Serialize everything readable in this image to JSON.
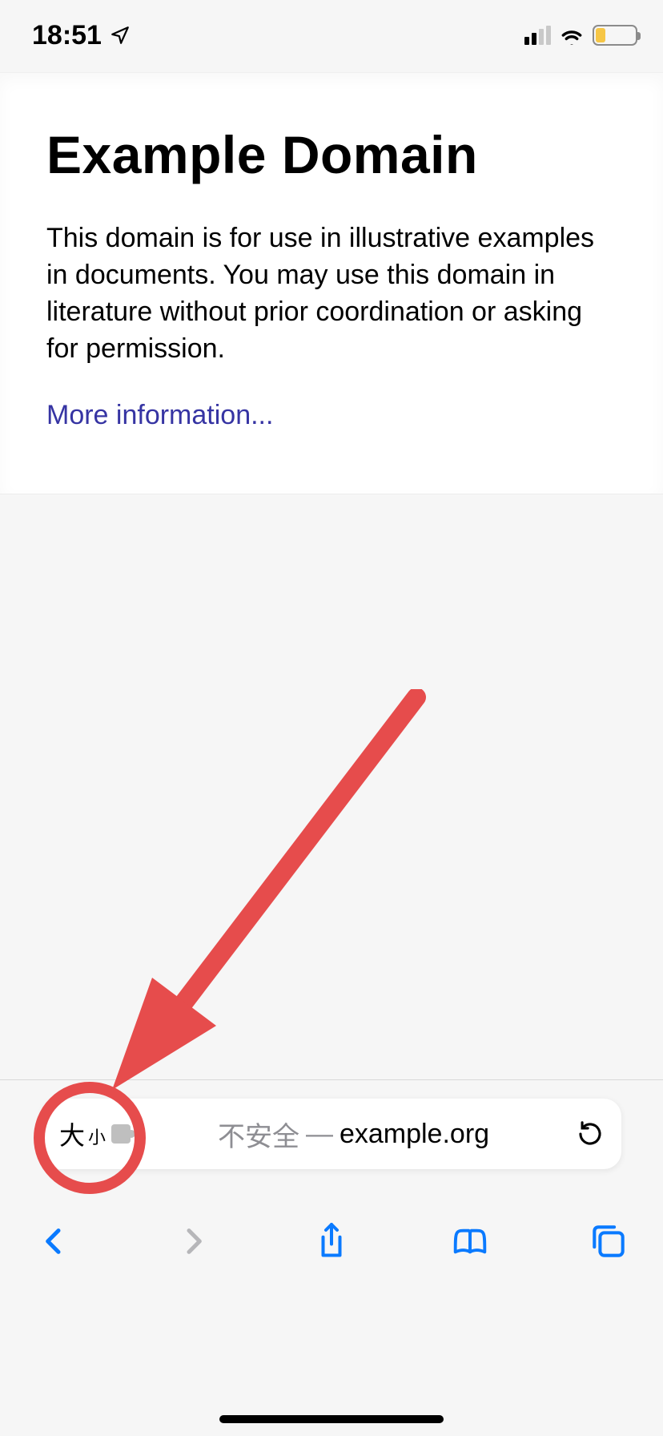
{
  "status": {
    "time": "18:51"
  },
  "page": {
    "title": "Example Domain",
    "body": "This domain is for use in illustrative examples in documents. You may use this domain in literature without prior coordination or asking for permission.",
    "more_link": "More information..."
  },
  "urlbar": {
    "size_label_big": "大",
    "size_label_small": "小",
    "insecure_label": "不安全",
    "dash": "—",
    "domain": "example.org"
  }
}
